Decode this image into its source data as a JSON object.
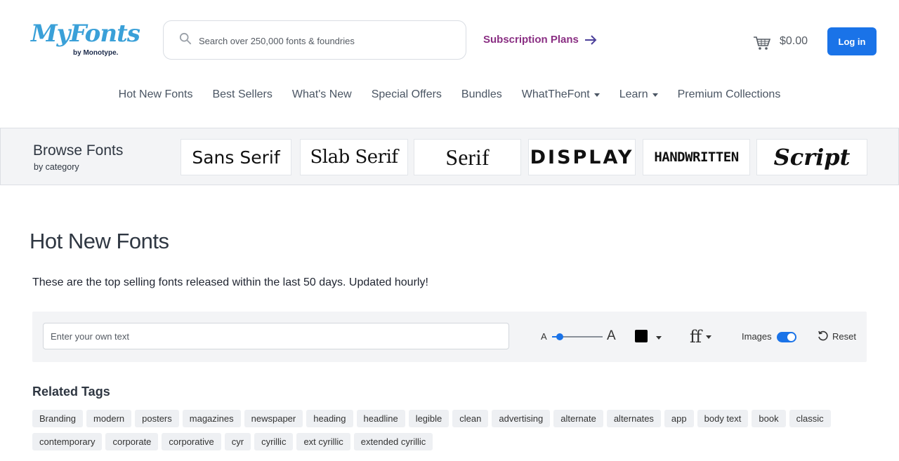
{
  "header": {
    "logo_text": "MyFonts",
    "logo_sub": "by Monotype.",
    "search_placeholder": "Search over 250,000 fonts & foundries",
    "subscription_label": "Subscription Plans",
    "cart_total": "$0.00",
    "login_label": "Log in"
  },
  "nav": {
    "items": [
      {
        "label": "Hot New Fonts"
      },
      {
        "label": "Best Sellers"
      },
      {
        "label": "What's New"
      },
      {
        "label": "Special Offers"
      },
      {
        "label": "Bundles"
      },
      {
        "label": "WhatTheFont",
        "dropdown": true
      },
      {
        "label": "Learn",
        "dropdown": true
      },
      {
        "label": "Premium Collections"
      }
    ]
  },
  "browse": {
    "title": "Browse Fonts",
    "subtitle": "by category",
    "categories": [
      "Sans Serif",
      "Slab Serif",
      "Serif",
      "DISPLAY",
      "HANDWRITTEN",
      "Script"
    ]
  },
  "page": {
    "title": "Hot New Fonts",
    "description": "These are the top selling fonts released within the last 50 days. Updated hourly!"
  },
  "toolbar": {
    "text_placeholder": "Enter your own text",
    "size_small_label": "A",
    "size_large_label": "A",
    "size_slider_fraction": 0.15,
    "text_color": "#000000",
    "background_color": "#ffffff",
    "ligature_glyph": "ff",
    "images_label": "Images",
    "images_enabled": true,
    "reset_label": "Reset"
  },
  "tags": {
    "title": "Related Tags",
    "items": [
      "Branding",
      "modern",
      "posters",
      "magazines",
      "newspaper",
      "heading",
      "headline",
      "legible",
      "clean",
      "advertising",
      "alternate",
      "alternates",
      "app",
      "body text",
      "book",
      "classic",
      "contemporary",
      "corporate",
      "corporative",
      "cyr",
      "cyrillic",
      "ext cyrillic",
      "extended cyrillic"
    ]
  },
  "colors": {
    "accent": "#1a73e8",
    "subscription": "#8a2f83",
    "logo": "#3aa0d8"
  }
}
